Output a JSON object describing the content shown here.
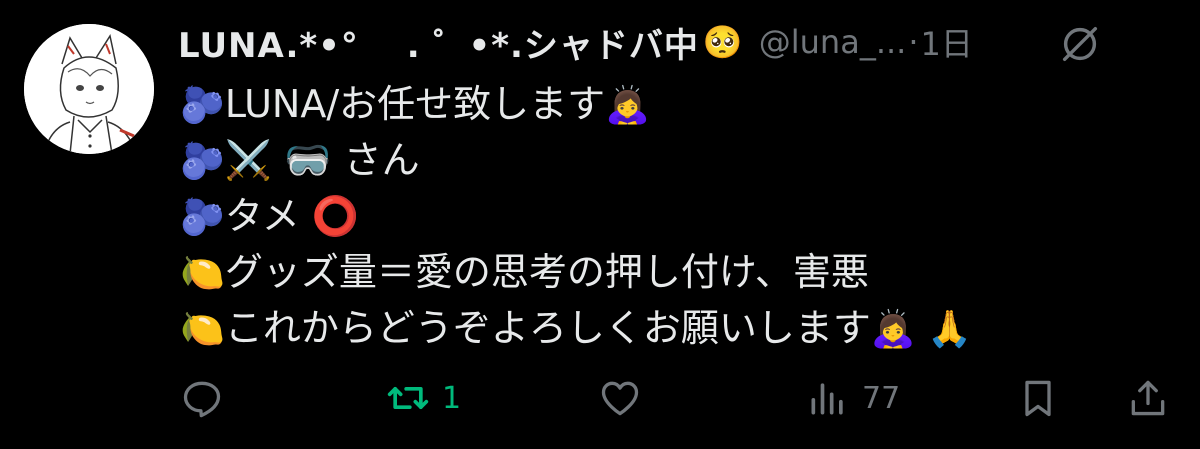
{
  "post": {
    "display_name": "LUNA.*•° 　. ゜•*.シャドバ中",
    "display_name_emoji": "🥺",
    "handle": "@luna_...",
    "separator": "·",
    "time": "1日",
    "lines": [
      {
        "emoji": "🫐",
        "text": "LUNA/お任せ致します",
        "trail": "🙇‍♀️"
      },
      {
        "emoji": "🫐",
        "text": "⚔️ 🥽 さん",
        "trail": ""
      },
      {
        "emoji": "🫐",
        "text": "タメ ⭕",
        "trail": ""
      },
      {
        "emoji": "🍋",
        "text": "グッズ量＝愛の思考の押し付け、害悪",
        "trail": ""
      },
      {
        "emoji": "🍋",
        "text": "これからどうぞよろしくお願いします",
        "trail": "🙇‍♀️ 🙏"
      }
    ]
  },
  "actions": {
    "reply_count": "",
    "retweet_count": "1",
    "like_count": "",
    "views_count": "77"
  },
  "colors": {
    "background": "#000000",
    "text": "#e7e9ea",
    "muted": "#71767b",
    "retweet": "#00ba7c"
  },
  "icons": [
    "avatar",
    "grok-icon",
    "reply-icon",
    "retweet-icon",
    "like-icon",
    "views-icon",
    "bookmark-icon",
    "share-icon"
  ]
}
